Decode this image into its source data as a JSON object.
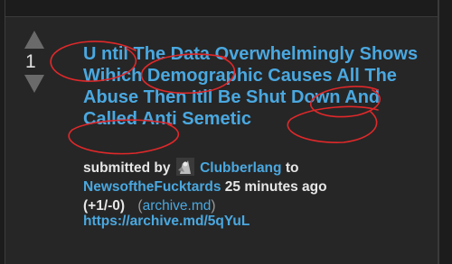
{
  "post": {
    "score": "1",
    "title": "U ntil The Data Overwhelmingly Shows Wihich Demographic Causes All The Abuse Then Itll Be Shut Down And Called Anti Semetic",
    "submitted_by_label": "submitted by",
    "author": "Clubberlang",
    "to_label": "to",
    "subreddit": "NewsoftheFucktards",
    "time_ago": "25 minutes ago",
    "votes": "(+1/-0)",
    "domain_open": "(",
    "domain": "archive.md",
    "domain_close": ")",
    "url": "https://archive.md/5qYuL"
  },
  "icons": {
    "upvote": "upvote-arrow-icon",
    "downvote": "downvote-arrow-icon"
  },
  "colors": {
    "background": "#262626",
    "link": "#4aa8e0",
    "annotation": "#e0282a",
    "arrow": "#6a6a6a"
  }
}
